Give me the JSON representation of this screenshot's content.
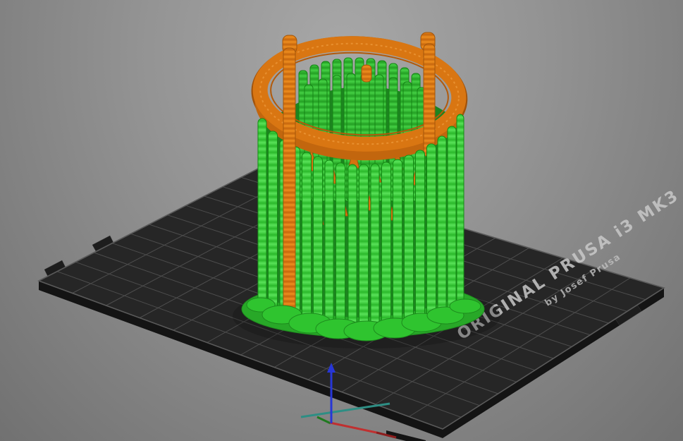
{
  "bed": {
    "brand_line1": "ORIGINAL PRUSA i3 MK3",
    "brand_line2": "by Josef Prusa"
  },
  "colors": {
    "background": "#949494",
    "bed_surface": "#262626",
    "bed_grid_line": "#4d4d4d",
    "bed_side": "#141414",
    "bed_text": "#c9c9c9",
    "object_orange": "#d97612",
    "support_green": "#33cc33",
    "support_green_dark": "#1d8420",
    "axis_z_blue": "#2736d6",
    "axis_x_red": "#c03030",
    "axis_x_red_dark": "#8c1d1d",
    "axis_y_teal": "#2e8e84"
  }
}
